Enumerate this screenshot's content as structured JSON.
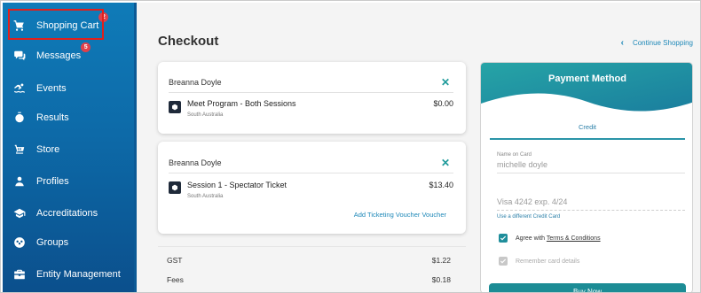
{
  "sidebar": {
    "items": [
      {
        "label": "Shopping Cart",
        "icon": "cart-icon",
        "badge": "2"
      },
      {
        "label": "Messages",
        "icon": "chat-icon",
        "badge": "5"
      },
      {
        "label": "Events",
        "icon": "swimmer-icon"
      },
      {
        "label": "Results",
        "icon": "stopwatch-icon"
      },
      {
        "label": "Store",
        "icon": "basket-icon"
      },
      {
        "label": "Profiles",
        "icon": "person-icon"
      },
      {
        "label": "Accreditations",
        "icon": "graduation-cap-icon"
      },
      {
        "label": "Groups",
        "icon": "groups-icon"
      },
      {
        "label": "Entity Management",
        "icon": "briefcase-icon"
      }
    ]
  },
  "main": {
    "title": "Checkout",
    "continue_label": "Continue Shopping",
    "cart": [
      {
        "attendee": "Breanna Doyle",
        "item_name": "Meet Program - Both Sessions",
        "item_sub": "South Australia",
        "price": "$0.00"
      },
      {
        "attendee": "Breanna Doyle",
        "item_name": "Session 1 - Spectator Ticket",
        "item_sub": "South Australia",
        "price": "$13.40",
        "voucher_link": "Add Ticketing Voucher Voucher"
      }
    ],
    "totals": [
      {
        "label": "GST",
        "amount": "$1.22"
      },
      {
        "label": "Fees",
        "amount": "$0.18"
      }
    ]
  },
  "payment": {
    "title": "Payment Method",
    "tab": "Credit",
    "name_label": "Name on Card",
    "name_value": "michelle doyle",
    "card_value": "Visa 4242 exp. 4/24",
    "use_different": "Use a different Credit Card",
    "agree_prefix": "Agree with ",
    "agree_link": "Terms & Conditions",
    "remember": "Remember card details",
    "buy_label": "Buy Now"
  },
  "colors": {
    "sidebar": "#0d6aa8",
    "accent": "#1c8c95",
    "badge": "#e0404a",
    "highlight": "#e0201c",
    "link": "#1e88b8"
  }
}
